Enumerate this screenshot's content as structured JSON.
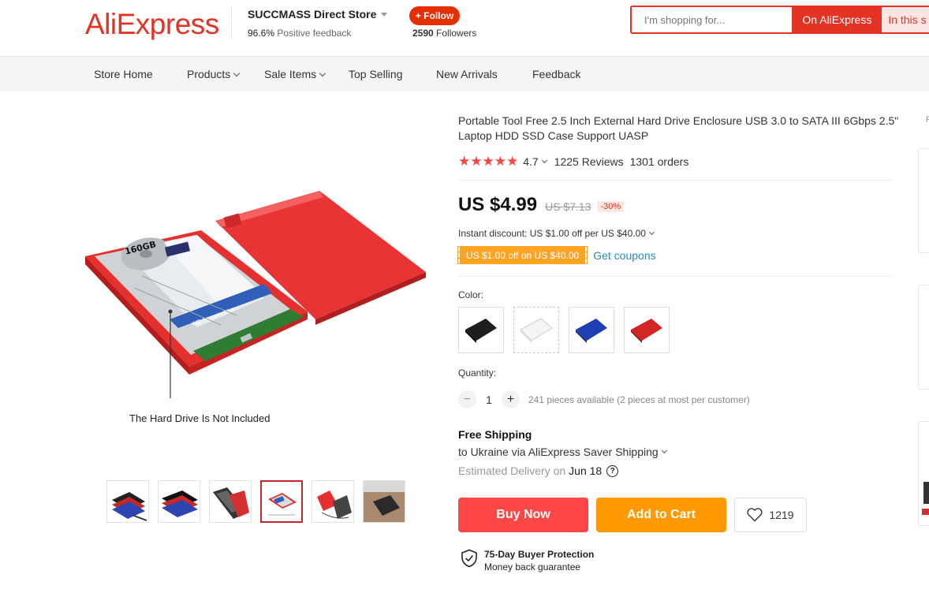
{
  "header": {
    "logo": "AliExpress",
    "store_name": "SUCCMASS Direct Store",
    "feedback_percent": "96.6%",
    "feedback_label": "Positive feedback",
    "follow_label": "+ Follow",
    "followers_count": "2590",
    "followers_label": "Followers",
    "search_placeholder": "I'm shopping for...",
    "search_ali_label": "On AliExpress",
    "search_store_label": "In this s"
  },
  "nav": {
    "items": [
      "Store Home",
      "Products",
      "Sale Items",
      "Top Selling",
      "New Arrivals",
      "Feedback"
    ]
  },
  "gallery": {
    "caption": "The Hard Drive Is Not Included",
    "hdd_label": "160GB",
    "hdd_brand": "WD",
    "hdd_series": "WD Scorpio Blue"
  },
  "product": {
    "title": "Portable Tool Free 2.5 Inch External Hard Drive Enclosure USB 3.0 to SATA III 6Gbps 2.5\" Laptop HDD SSD Case Support UASP",
    "stars": "★★★★★",
    "rating": "4.7",
    "reviews": "1225 Reviews",
    "orders": "1301 orders",
    "price": "US $4.99",
    "old_price": "US $7.13",
    "discount": "-30%",
    "instant_discount": "Instant discount: US $1.00 off per US $40.00",
    "coupon": "US $1.00 off on US $40.00",
    "get_coupons": "Get coupons",
    "color_label": "Color:",
    "quantity_label": "Quantity:",
    "quantity_value": "1",
    "quantity_minus": "−",
    "quantity_plus": "+",
    "availability": "241 pieces available (2 pieces at most per customer)",
    "shipping_title": "Free Shipping",
    "shipping_to": "to Ukraine via AliExpress Saver Shipping",
    "delivery_label": "Estimated Delivery on",
    "delivery_date": "Jun 18",
    "help_glyph": "?",
    "buy_now": "Buy Now",
    "add_to_cart": "Add to Cart",
    "wishlist_count": "1219",
    "protection_title": "75-Day Buyer Protection",
    "protection_sub": "Money back guarantee",
    "right_panel_letter": "F"
  },
  "colors": {
    "brand": "#e43225",
    "buy_now": "#ff4747",
    "add_to_cart": "#ff9a03",
    "coupon": "#fea322",
    "link": "#2a8ab8",
    "stars": "#ff4444"
  },
  "swatches": [
    "black",
    "white",
    "blue",
    "red"
  ]
}
